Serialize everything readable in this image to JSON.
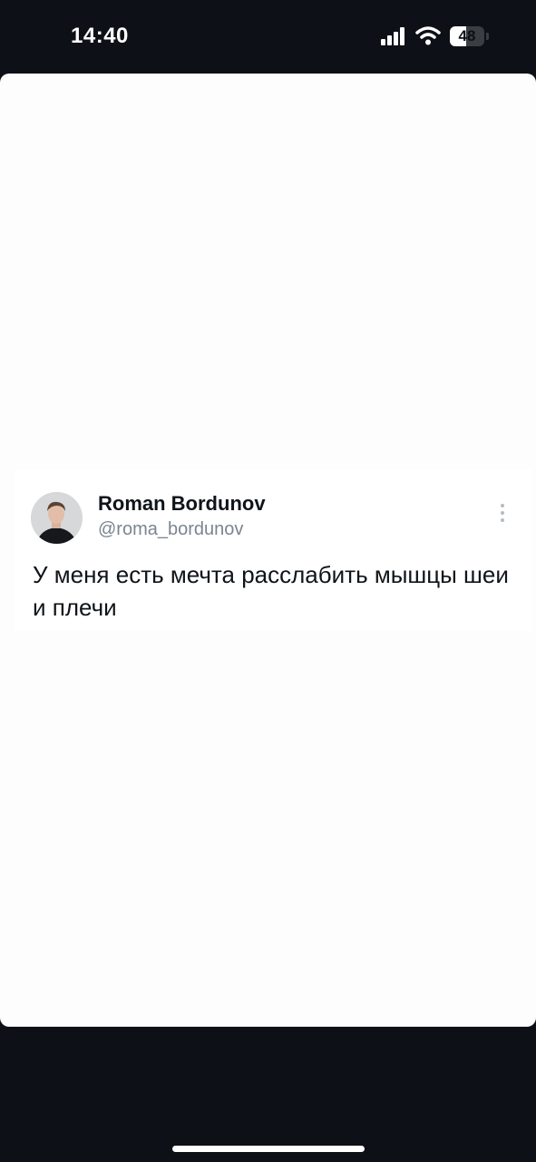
{
  "status_bar": {
    "time": "14:40",
    "battery_level": "48",
    "battery_fraction": 0.48,
    "icons": [
      "signal-icon",
      "wifi-icon",
      "battery-icon"
    ]
  },
  "tweet": {
    "author_name": "Roman Bordunov",
    "author_handle": "@roma_bordunov",
    "text": "У меня есть мечта расслабить мышцы шеи и плечи",
    "icons": [
      "avatar",
      "more-icon"
    ]
  },
  "colors": {
    "background": "#0d1117",
    "card": "#fdfdfd",
    "text_primary": "#0f1419",
    "text_secondary": "#7a8590"
  }
}
